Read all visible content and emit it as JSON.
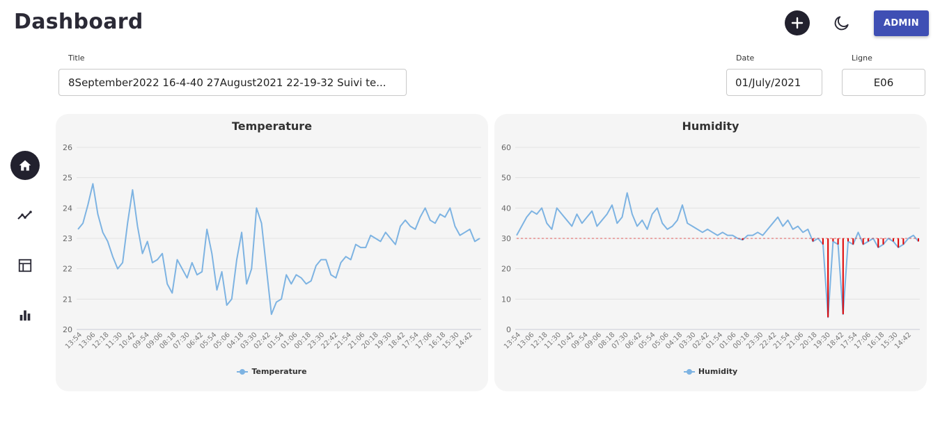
{
  "header": {
    "title": "Dashboard",
    "add_icon": "plus-icon",
    "theme_icon": "moon-icon",
    "admin_label": "ADMIN"
  },
  "filters": {
    "title_label": "Title",
    "title_value": "8September2022 16-4-40 27August2021 22-19-32 Suivi te...",
    "date_label": "Date",
    "date_value": "01/July/2021",
    "ligne_label": "Ligne",
    "ligne_value": "E06"
  },
  "sidebar": {
    "items": [
      {
        "icon": "home-icon",
        "active": true
      },
      {
        "icon": "trend-line-icon",
        "active": false
      },
      {
        "icon": "table-icon",
        "active": false
      },
      {
        "icon": "bar-chart-icon",
        "active": false
      }
    ]
  },
  "colors": {
    "accent": "#3f4fb4",
    "series": "#7db3e2",
    "alert": "#e00000",
    "dark": "#22212e"
  },
  "chart_data": [
    {
      "type": "line",
      "title": "Temperature",
      "ylim": [
        20,
        26
      ],
      "yticks": [
        20,
        21,
        22,
        23,
        24,
        25,
        26
      ],
      "grid": true,
      "legend_position": "bottom",
      "x_tick_labels": [
        "13:54",
        "13:06",
        "12:18",
        "11:30",
        "10:42",
        "09:54",
        "09:06",
        "08:18",
        "07:30",
        "06:42",
        "05:54",
        "05:06",
        "04:18",
        "03:30",
        "02:42",
        "01:54",
        "01:06",
        "00:18",
        "23:30",
        "22:42",
        "21:54",
        "21:06",
        "20:18",
        "19:30",
        "18:42",
        "17:54",
        "17:06",
        "16:18",
        "15:30",
        "14:42"
      ],
      "series": [
        {
          "name": "Temperature",
          "values": [
            23.3,
            23.5,
            24.1,
            24.8,
            23.8,
            23.2,
            22.9,
            22.4,
            22.0,
            22.2,
            23.5,
            24.6,
            23.4,
            22.5,
            22.9,
            22.2,
            22.3,
            22.5,
            21.5,
            21.2,
            22.3,
            22.0,
            21.7,
            22.2,
            21.8,
            21.9,
            23.3,
            22.5,
            21.3,
            21.9,
            20.8,
            21.0,
            22.3,
            23.2,
            21.5,
            22.0,
            24.0,
            23.5,
            22.0,
            20.5,
            20.9,
            21.0,
            21.8,
            21.5,
            21.8,
            21.7,
            21.5,
            21.6,
            22.1,
            22.3,
            22.3,
            21.8,
            21.7,
            22.2,
            22.4,
            22.3,
            22.8,
            22.7,
            22.7,
            23.1,
            23.0,
            22.9,
            23.2,
            23.0,
            22.8,
            23.4,
            23.6,
            23.4,
            23.3,
            23.7,
            24.0,
            23.6,
            23.5,
            23.8,
            23.7,
            24.0,
            23.4,
            23.1,
            23.2,
            23.3,
            22.9,
            23.0
          ]
        }
      ]
    },
    {
      "type": "line",
      "title": "Humidity",
      "ylim": [
        0,
        60
      ],
      "yticks": [
        0,
        10,
        20,
        30,
        40,
        50,
        60
      ],
      "grid": true,
      "legend_position": "bottom",
      "threshold": 30,
      "x_tick_labels": [
        "13:54",
        "13:06",
        "12:18",
        "11:30",
        "10:42",
        "09:54",
        "09:06",
        "08:18",
        "07:30",
        "06:42",
        "05:54",
        "05:06",
        "04:18",
        "03:30",
        "02:42",
        "01:54",
        "01:06",
        "00:18",
        "23:30",
        "22:42",
        "21:54",
        "21:06",
        "20:18",
        "19:30",
        "18:42",
        "17:54",
        "17:06",
        "16:18",
        "15:30",
        "14:42"
      ],
      "series": [
        {
          "name": "Humidity",
          "values": [
            31,
            34,
            37,
            39,
            38,
            40,
            35,
            33,
            40,
            38,
            36,
            34,
            38,
            35,
            37,
            39,
            34,
            36,
            38,
            41,
            35,
            37,
            45,
            38,
            34,
            36,
            33,
            38,
            40,
            35,
            33,
            34,
            36,
            41,
            35,
            34,
            33,
            32,
            33,
            32,
            31,
            32,
            31,
            31,
            30,
            29.5,
            31,
            31,
            32,
            31,
            33,
            35,
            37,
            34,
            36,
            33,
            34,
            32,
            33,
            29,
            30,
            28,
            4,
            29,
            28,
            5,
            29,
            28,
            32,
            28,
            29,
            30,
            27,
            28,
            30,
            29,
            27,
            28,
            30,
            31,
            29
          ]
        }
      ]
    }
  ]
}
